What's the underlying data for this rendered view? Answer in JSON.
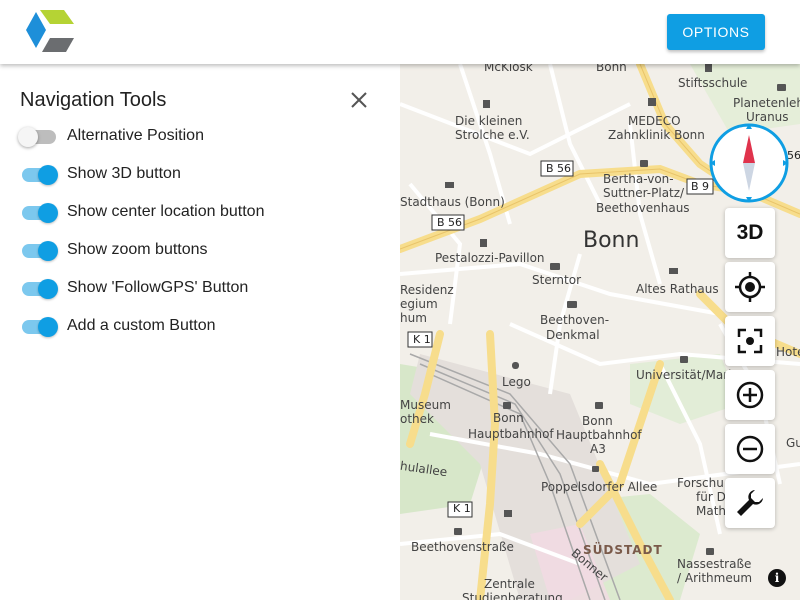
{
  "header": {
    "options_label": "OPTIONS"
  },
  "panel": {
    "title": "Navigation Tools",
    "options": [
      {
        "label": "Alternative Position",
        "on": false
      },
      {
        "label": "Show 3D button",
        "on": true
      },
      {
        "label": "Show center location button",
        "on": true
      },
      {
        "label": "Show zoom buttons",
        "on": true
      },
      {
        "label": "Show 'FollowGPS' Button",
        "on": true
      },
      {
        "label": "Add a custom Button",
        "on": true
      }
    ]
  },
  "map": {
    "button_3d_label": "3D",
    "labels": {
      "l1": "McKiosk",
      "l2": "Bonn",
      "l3": "Stiftsschule",
      "l4": "Planetenleh",
      "l5": "Uranus",
      "l6": "Die kleinen",
      "l7": "Strolche e.V.",
      "l8": "MEDECO",
      "l9": "Zahnklinik Bonn",
      "l10": "B 56",
      "l11": "Bertha-von-",
      "l12": "Suttner-Platz/",
      "l13": "Beethovenhaus",
      "l14": "B 9",
      "l15": "Stadthaus (Bonn)",
      "l16": "B 56",
      "l17": "Bonn",
      "l18": "Pestalozzi-Pavillon",
      "l19": "Sterntor",
      "l20": "Altes Rathaus",
      "l21": "Residenz",
      "l22": "egium",
      "l23": "hum",
      "l24": "Beethoven-",
      "l25": "Denkmal",
      "l26": "K 1",
      "l27": "Hote",
      "l28": "Lego",
      "l29": "Universität/Mark",
      "l30": "Museum",
      "l31": "othek",
      "l32": "Bonn",
      "l33": "Hauptbahnhof",
      "l34": "Bonn",
      "l35": "Hauptbahnhof",
      "l36": "A3",
      "l37": "hulallee",
      "l38": "Poppelsdorfer Allee",
      "l39": "Forschu",
      "l40": "für D",
      "l41": "Math",
      "l42": "K 1",
      "l43": "Beethovenstraße",
      "l44": "SÜDSTADT",
      "l45": "Nassestraße",
      "l46": "/ Arithmeum",
      "l47": "Zentrale",
      "l48": "Studienberatung",
      "l49": "Bonner",
      "l50": "56",
      "l51": "Gu"
    }
  },
  "colors": {
    "accent": "#0f9ee3",
    "compass_red": "#e0334c",
    "map_background": "#f2efe9",
    "major_road": "#f7dd8c"
  }
}
